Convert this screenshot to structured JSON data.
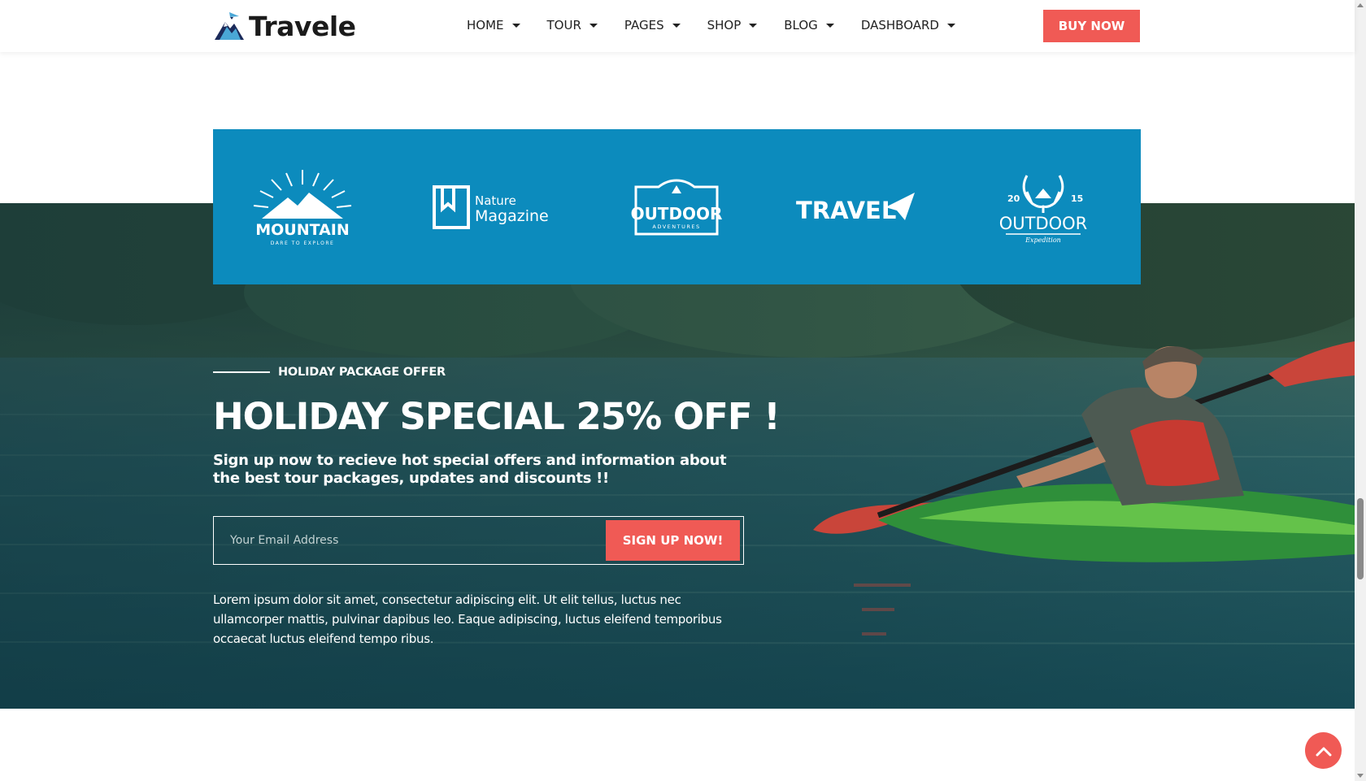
{
  "brand": {
    "name": "Travele",
    "icon": "mountain-plane-logo"
  },
  "nav": {
    "items": [
      {
        "label": "HOME"
      },
      {
        "label": "TOUR"
      },
      {
        "label": "PAGES"
      },
      {
        "label": "SHOP"
      },
      {
        "label": "BLOG"
      },
      {
        "label": "DASHBOARD"
      }
    ],
    "buy_label": "BUY NOW"
  },
  "partners": [
    {
      "name": "MOUNTAIN",
      "tagline": "DARE TO EXPLORE"
    },
    {
      "name": "Magazine",
      "tagline": "Nature"
    },
    {
      "name": "OUTDOOR",
      "tagline": "ADVENTURES"
    },
    {
      "name": "TRAVEL",
      "tagline": ""
    },
    {
      "name": "OUTDOOR",
      "tagline": "Expedition",
      "year_left": "20",
      "year_right": "15"
    }
  ],
  "offer": {
    "kicker": "HOLIDAY PACKAGE OFFER",
    "headline": "HOLIDAY SPECIAL 25% OFF !",
    "subline": "Sign up now to recieve hot special offers and information about the best tour packages, updates and discounts !!",
    "email_placeholder": "Your Email Address",
    "signup_label": "SIGN UP NOW!",
    "body": "Lorem ipsum dolor sit amet, consectetur adipiscing elit. Ut elit tellus, luctus nec ullamcorper mattis, pulvinar dapibus leo. Eaque adipiscing, luctus eleifend temporibus occaecat luctus eleifend tempo ribus."
  },
  "colors": {
    "accent": "#f05a55",
    "band": "#0c8bbd",
    "dark": "#1b1b1b"
  },
  "icons": {
    "back_to_top": "chevron-up-icon",
    "nav_caret": "caret-down-icon"
  }
}
